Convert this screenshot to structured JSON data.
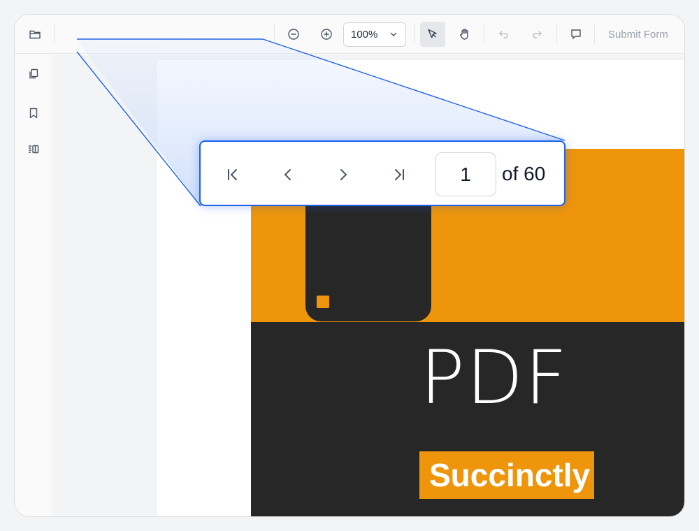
{
  "toolbar": {
    "open_icon": "folder-open-icon",
    "zoom_out_icon": "zoom-out-icon",
    "zoom_in_icon": "zoom-in-icon",
    "zoom_value": "100%",
    "select_tool_icon": "cursor-icon",
    "pan_tool_icon": "hand-icon",
    "undo_icon": "undo-icon",
    "redo_icon": "redo-icon",
    "comment_icon": "comment-icon",
    "submit_label": "Submit Form"
  },
  "sidebar": {
    "items": [
      {
        "name": "page-thumbnails",
        "icon": "copy-pages-icon"
      },
      {
        "name": "bookmarks",
        "icon": "bookmark-icon"
      },
      {
        "name": "organize-pages",
        "icon": "organize-pages-icon"
      }
    ]
  },
  "document": {
    "cover_title": "PDF",
    "cover_subtitle": "Succinctly",
    "colors": {
      "orange": "#ee950b",
      "dark": "#272727"
    }
  },
  "pagination": {
    "first_icon": "first-page-icon",
    "prev_icon": "chevron-left-icon",
    "next_icon": "chevron-right-icon",
    "last_icon": "last-page-icon",
    "current_page": "1",
    "total_label": "of 60"
  },
  "accent_color": "#1d62e8"
}
